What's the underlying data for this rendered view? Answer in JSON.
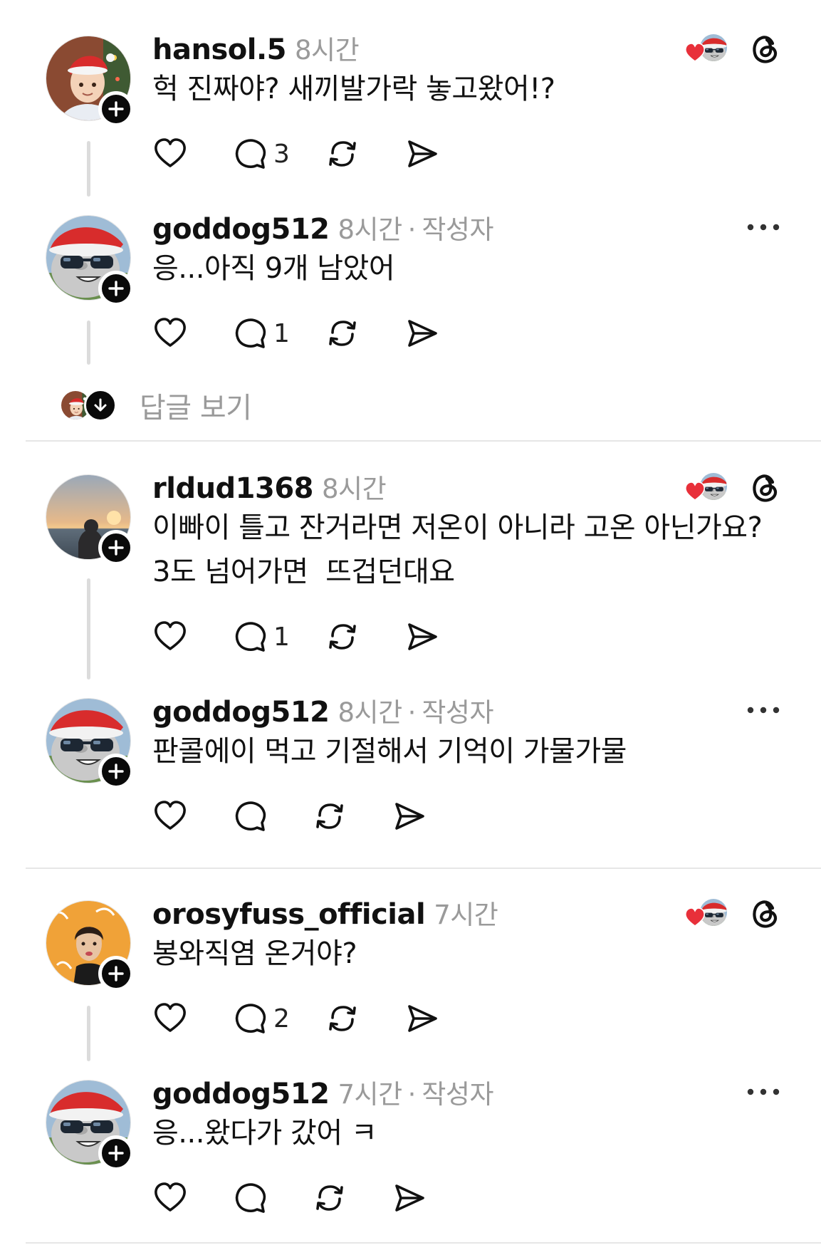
{
  "threads": [
    {
      "reply": {
        "username": "hansol.5",
        "time": "8시간",
        "text": "헉 진짜야? 새끼발가락 놓고왔어!?",
        "reply_count": "3",
        "avatar": "santa-hat-character-avatar"
      },
      "author_reply": {
        "username": "goddog512",
        "time": "8시간",
        "author_tag": "작성자",
        "text": "응...아직 9개 남았어",
        "reply_count": "1",
        "avatar": "santa-hat-sunglasses-avatar"
      },
      "view_replies": "답글 보기"
    },
    {
      "reply": {
        "username": "rldud1368",
        "time": "8시간",
        "text_lines": [
          "이빠이 틀고 잔거라면 저온이 아니라 고온 아닌가요?",
          "3도 넘어가면  뜨겁던대요"
        ],
        "reply_count": "1",
        "avatar": "sunset-beach-avatar"
      },
      "author_reply": {
        "username": "goddog512",
        "time": "8시간",
        "author_tag": "작성자",
        "text": "판콜에이 먹고 기절해서 기억이 가물가물",
        "reply_count": "",
        "avatar": "santa-hat-sunglasses-avatar"
      }
    },
    {
      "reply": {
        "username": "orosyfuss_official",
        "time": "7시간",
        "text": "봉와직염 온거야?",
        "reply_count": "2",
        "avatar": "woman-orange-background-avatar"
      },
      "author_reply": {
        "username": "goddog512",
        "time": "7시간",
        "author_tag": "작성자",
        "text": "응...왔다가 갔어 ㅋ",
        "reply_count": "",
        "avatar": "santa-hat-sunglasses-avatar"
      }
    }
  ],
  "separator": "·",
  "colors": {
    "text": "#111111",
    "secondary": "#9a9a9a",
    "heart_red": "#e8303a",
    "divider": "#e6e6e6",
    "thread_line": "#dcdcdc"
  }
}
